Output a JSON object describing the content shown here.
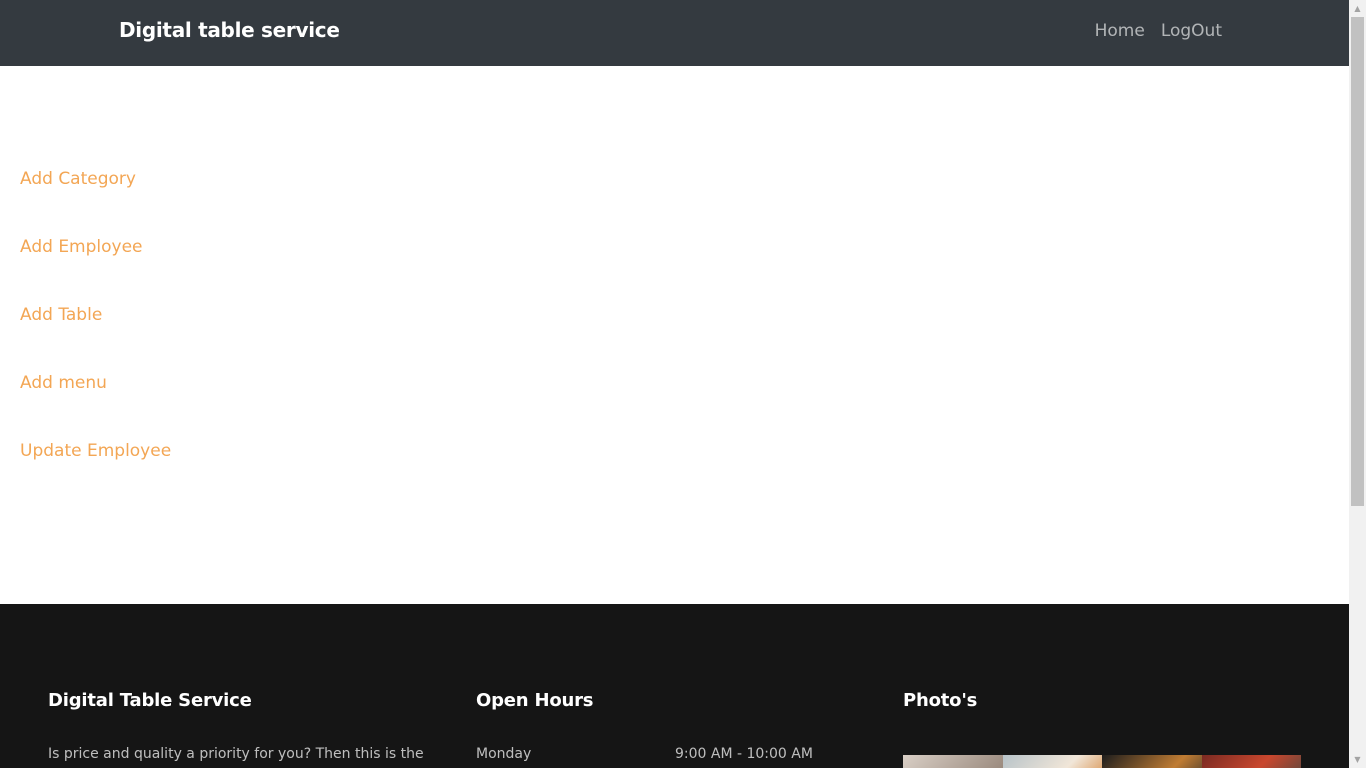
{
  "navbar": {
    "brand": "Digital table service",
    "links": [
      "Home",
      "LogOut"
    ]
  },
  "admin": {
    "links": [
      "Add Category",
      "Add Employee",
      "Add Table",
      "Add menu",
      "Update Employee"
    ]
  },
  "footer": {
    "about": {
      "heading": "Digital Table Service",
      "text": "Is price and quality a priority for you? Then this is the"
    },
    "hours": {
      "heading": "Open Hours",
      "day": "Monday",
      "time": "9:00 AM - 10:00 AM"
    },
    "photos": {
      "heading": "Photo's"
    }
  },
  "colors": {
    "navbar_bg": "#343a40",
    "link_accent": "#f3a654",
    "footer_bg": "#151515"
  }
}
